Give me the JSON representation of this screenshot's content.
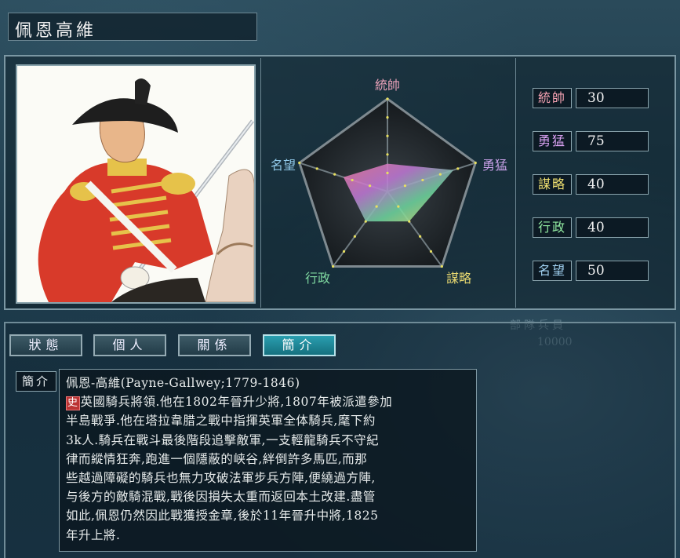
{
  "character": {
    "name": "佩恩高維"
  },
  "radar": {
    "labels": {
      "command": "統帥",
      "valor": "勇猛",
      "strategy": "謀略",
      "admin": "行政",
      "fame": "名望"
    },
    "label_colors": {
      "command": "#e8a0b8",
      "valor": "#c8a0e8",
      "strategy": "#e8d870",
      "admin": "#7fd8a0",
      "fame": "#90c8e8"
    },
    "max": 100,
    "values": {
      "command": 30,
      "valor": 75,
      "strategy": 40,
      "admin": 40,
      "fame": 50
    }
  },
  "stats": [
    {
      "label": "統帥",
      "value": "30",
      "color": "#f2a0b0"
    },
    {
      "label": "勇猛",
      "value": "75",
      "color": "#d8a0f0"
    },
    {
      "label": "謀略",
      "value": "40",
      "color": "#f0e070"
    },
    {
      "label": "行政",
      "value": "40",
      "color": "#90e8a0"
    },
    {
      "label": "名望",
      "value": "50",
      "color": "#a0d0f0"
    }
  ],
  "tabs": [
    {
      "label": "狀態",
      "active": false
    },
    {
      "label": "個人",
      "active": false
    },
    {
      "label": "關係",
      "active": false
    },
    {
      "label": "簡介",
      "active": true
    }
  ],
  "bio": {
    "label": "簡介",
    "badge": "史",
    "heading": "佩恩-高維(Payne-Gallwey;1779-1846)",
    "lines": [
      "英國騎兵將領.他在1802年晉升少將,1807年被派遣參加",
      "半島戰爭.他在塔拉韋腊之戰中指揮英軍全体騎兵,麾下約",
      "3k人.騎兵在戰斗最後階段追擊敵軍,一支輕龍騎兵不守紀",
      "律而縱情狂奔,跑進一個隱蔽的峡谷,絆倒許多馬匹,而那",
      "些越過障礙的騎兵也無力攻破法軍步兵方陣,便繞過方陣,",
      "与後方的敵騎混戰,戰後因損失太重而返回本土改建.盡管",
      "如此,佩恩仍然因此戰獲授金章,後於11年晉升中將,1825",
      "年升上將."
    ]
  },
  "background_text": {
    "label": "部隊兵員",
    "value": "10000"
  }
}
